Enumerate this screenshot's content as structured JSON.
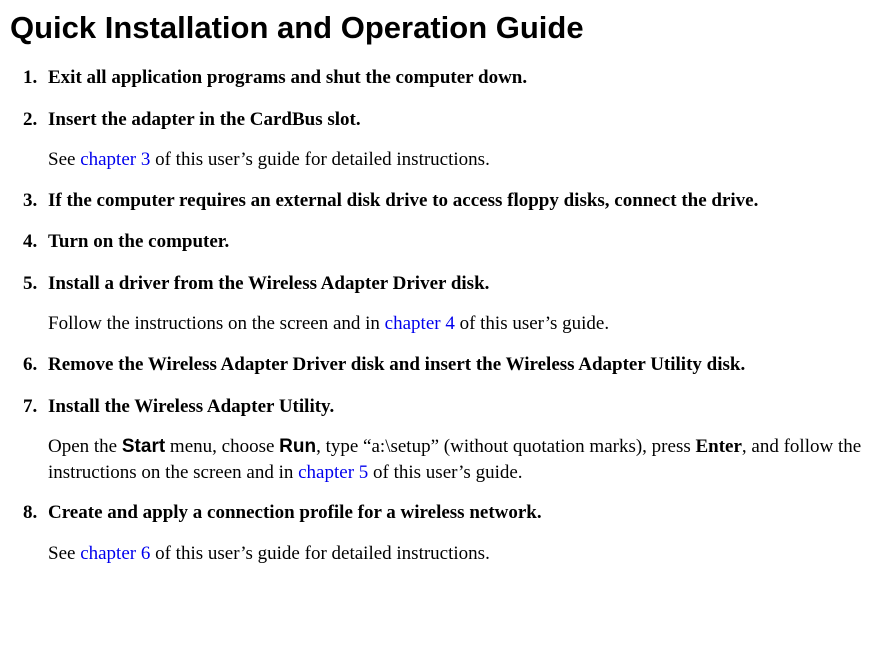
{
  "title": "Quick Installation and Operation Guide",
  "steps": [
    {
      "heading": "Exit all application programs and shut the computer down."
    },
    {
      "heading": "Insert the adapter in the CardBus slot.",
      "body_pre": "See ",
      "link": "chapter 3",
      "body_post": " of this user’s guide for detailed instructions."
    },
    {
      "heading": "If the computer requires an external disk drive to access floppy disks, connect the drive."
    },
    {
      "heading": "Turn on the computer."
    },
    {
      "heading": "Install a driver from the Wireless Adapter Driver disk.",
      "body_pre": "Follow the instructions on the screen and in ",
      "link": "chapter 4",
      "body_post": " of this user’s guide."
    },
    {
      "heading": "Remove the Wireless Adapter Driver disk and insert the Wireless Adapter Utility disk."
    },
    {
      "heading": "Install the Wireless Adapter Utility.",
      "body7_a": "Open the ",
      "body7_start": "Start",
      "body7_b": " menu, choose ",
      "body7_run": "Run",
      "body7_c": ", type “a:\\setup” (without quotation marks), press ",
      "body7_enter": "Enter",
      "body7_d": ", and follow the instructions on the screen and in ",
      "link": "chapter 5",
      "body7_e": " of this user’s guide."
    },
    {
      "heading": "Create and apply a connection profile for a wireless network.",
      "body_pre": "See ",
      "link": "chapter 6",
      "body_post": " of this user’s guide for detailed instructions."
    }
  ]
}
